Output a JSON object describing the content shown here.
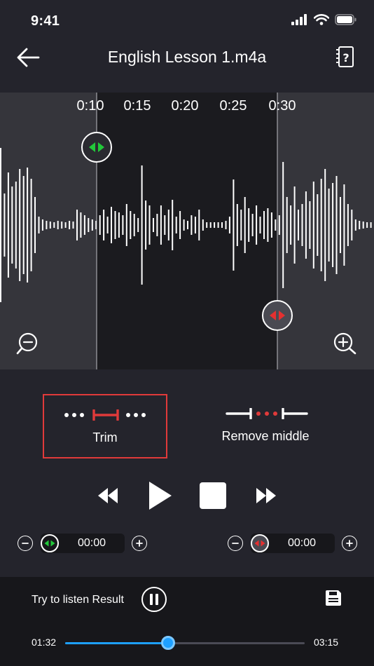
{
  "status": {
    "time": "9:41"
  },
  "nav": {
    "title": "English Lesson 1.m4a"
  },
  "timeline": {
    "ticks": [
      "0:10",
      "0:15",
      "0:20",
      "0:25",
      "0:30"
    ],
    "tick_seconds": [
      10,
      15,
      20,
      25,
      30
    ]
  },
  "modes": {
    "trim_label": "Trim",
    "remove_middle_label": "Remove middle",
    "selected": "trim"
  },
  "start_marker": {
    "value": "00:00"
  },
  "end_marker": {
    "value": "00:00"
  },
  "result": {
    "label": "Try to listen Result",
    "current_time": "01:32",
    "total_time": "03:15",
    "progress": 0.43
  },
  "colors": {
    "accent_blue": "#1ea0ff",
    "trim_red": "#e03a3a",
    "start_green": "#22c83a",
    "end_red": "#e53030",
    "background": "#24242c"
  },
  "icons": {
    "back": "arrow-left-icon",
    "help": "help-book-icon",
    "zoom_out": "zoom-out-icon",
    "zoom_in": "zoom-in-icon",
    "rewind": "rewind-icon",
    "play": "play-icon",
    "stop": "stop-icon",
    "fast_forward": "fast-forward-icon",
    "pause": "pause-icon",
    "save": "save-icon"
  }
}
